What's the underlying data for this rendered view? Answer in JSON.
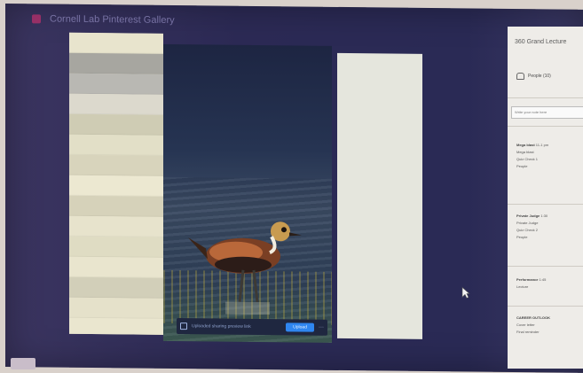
{
  "window": {
    "tab_title": "Cornell Lab Pinterest Gallery"
  },
  "left_pane_stripes": [
    "#e8e4cd",
    "#a7a6a0",
    "#b9b8b3",
    "#dcd9cd",
    "#cfccb4",
    "#e2dfc7",
    "#d8d4bc",
    "#ece8d1",
    "#d6d2ba",
    "#e7e3cc",
    "#dfdcc3",
    "#e9e5ce",
    "#d2cfb9",
    "#e5e1ca",
    "#eae6cf"
  ],
  "image": {
    "subject": "Pacific Golden-Plover standing in shallow water"
  },
  "hover_bar": {
    "text": "Uploaded sharing preview link",
    "button_label": "Upload",
    "more": "···"
  },
  "sidebar": {
    "title": "360 Grand Lecture",
    "people_label": "People (10)",
    "search_placeholder": "Write your note here",
    "entries": [
      {
        "name": "Mega blast",
        "meta": "11-1 pm",
        "lines": [
          "Mega blast",
          "Quiz Check 1",
          "People"
        ]
      },
      {
        "name": "Private Judge",
        "meta": "1:30",
        "lines": [
          "Private Judge",
          "Quiz Check 2",
          "People"
        ]
      },
      {
        "name": "Performance",
        "meta": "1:45",
        "lines": [
          "Lecture"
        ]
      },
      {
        "name": "CAREER OUTLOOK",
        "meta": "",
        "lines": [
          "Cover letter",
          "Final reminder"
        ]
      }
    ]
  },
  "colors": {
    "accent": "#2f86f0",
    "monitor_bg": "#2c2a55",
    "sidebar_bg": "#eeece8"
  }
}
